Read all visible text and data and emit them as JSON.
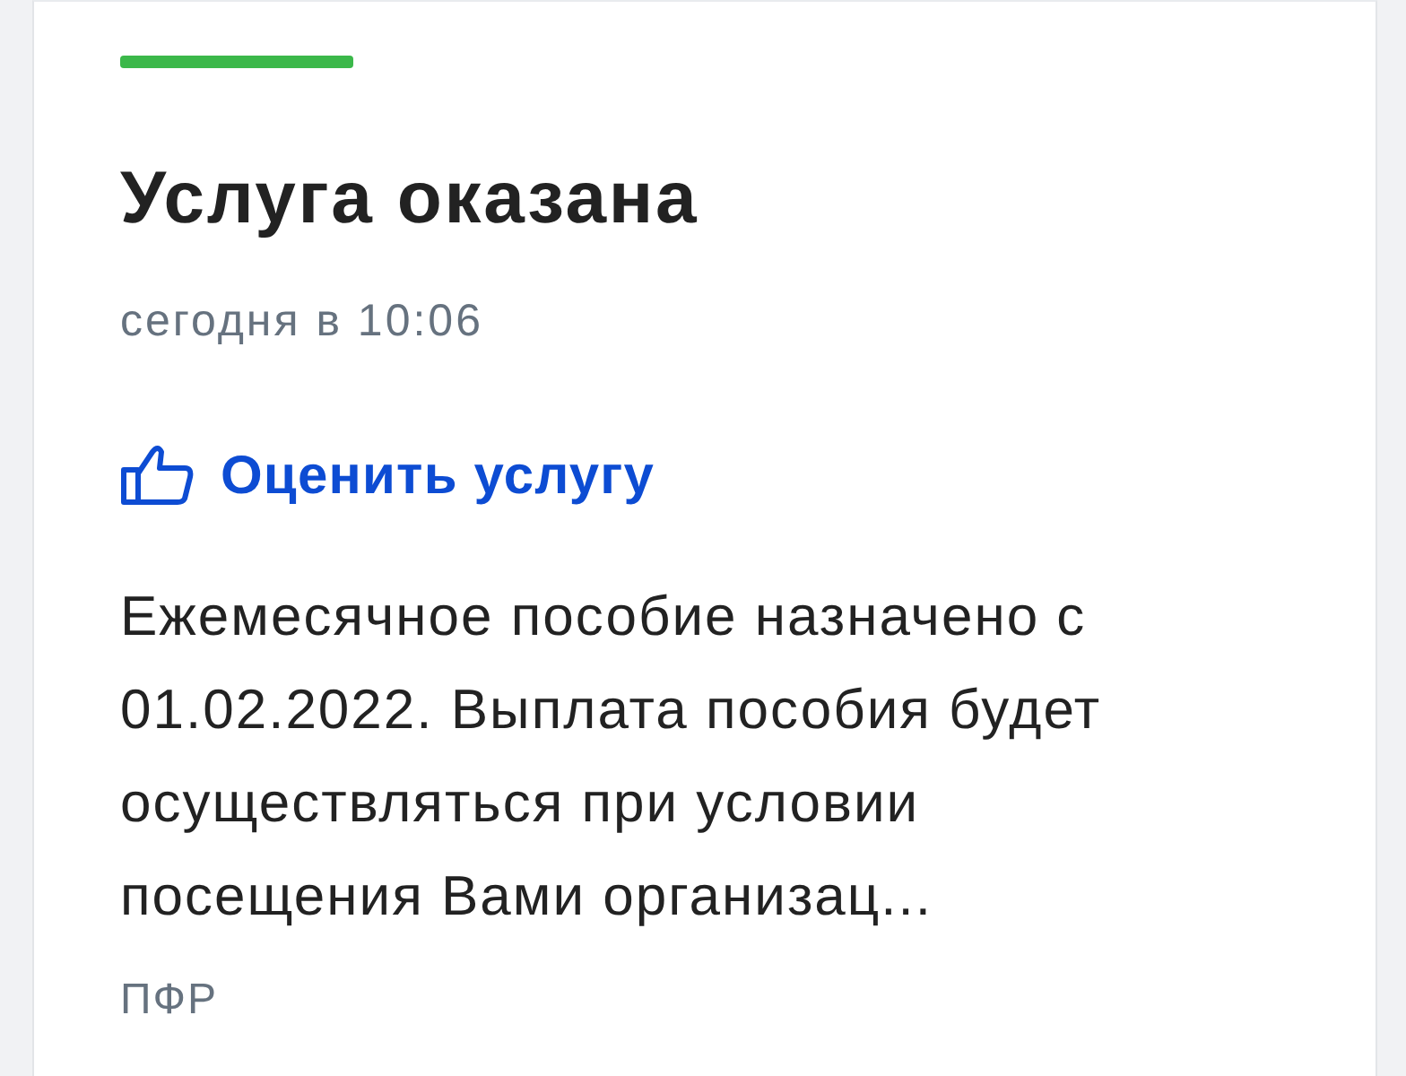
{
  "card": {
    "title": "Услуга оказана",
    "date": "сегодня в 10:06",
    "rate_link": "Оценить услугу",
    "message": "Ежемесячное пособие назначено с 01.02.2022. Выплата пособия будет осуществляться при условии посещения Вами организац...",
    "source": "ПФР"
  }
}
